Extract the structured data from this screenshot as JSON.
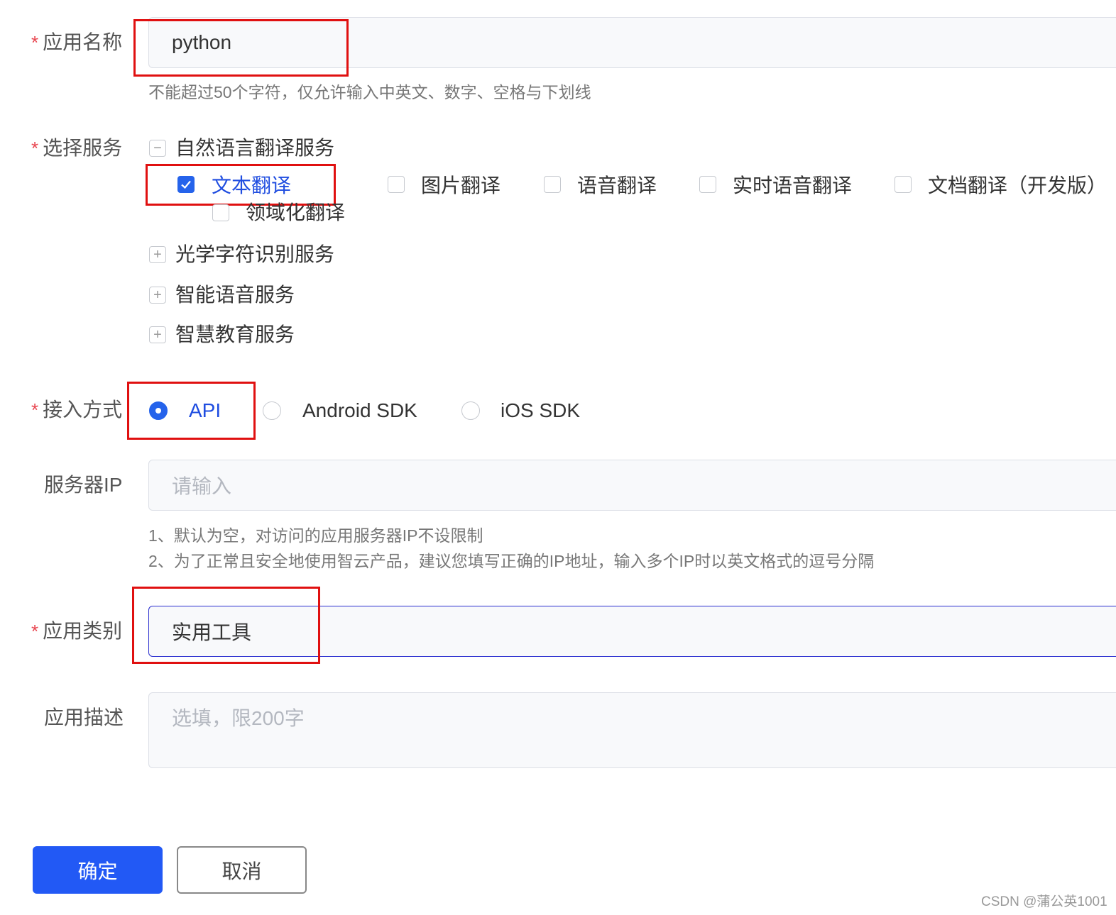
{
  "form": {
    "app_name": {
      "required_mark": "*",
      "label": "应用名称",
      "value": "python",
      "hint": "不能超过50个字符，仅允许输入中英文、数字、空格与下划线"
    },
    "services": {
      "required_mark": "*",
      "label": "选择服务",
      "groups": [
        {
          "label": "自然语言翻译服务",
          "toggle": "−",
          "expanded": true,
          "options": [
            {
              "label": "文本翻译",
              "checked": true
            },
            {
              "label": "图片翻译",
              "checked": false
            },
            {
              "label": "语音翻译",
              "checked": false
            },
            {
              "label": "实时语音翻译",
              "checked": false
            },
            {
              "label": "文档翻译（开发版）",
              "checked": false
            },
            {
              "label": "领域化翻译",
              "checked": false
            }
          ]
        },
        {
          "label": "光学字符识别服务",
          "toggle": "+",
          "expanded": false
        },
        {
          "label": "智能语音服务",
          "toggle": "+",
          "expanded": false
        },
        {
          "label": "智慧教育服务",
          "toggle": "+",
          "expanded": false
        }
      ]
    },
    "access_method": {
      "required_mark": "*",
      "label": "接入方式",
      "options": [
        {
          "label": "API",
          "selected": true
        },
        {
          "label": "Android SDK",
          "selected": false
        },
        {
          "label": "iOS SDK",
          "selected": false
        }
      ]
    },
    "server_ip": {
      "label": "服务器IP",
      "placeholder": "请输入",
      "hints": [
        "1、默认为空，对访问的应用服务器IP不设限制",
        "2、为了正常且安全地使用智云产品，建议您填写正确的IP地址，输入多个IP时以英文格式的逗号分隔"
      ]
    },
    "app_category": {
      "required_mark": "*",
      "label": "应用类别",
      "value": "实用工具"
    },
    "description": {
      "label": "应用描述",
      "placeholder": "选填，限200字"
    }
  },
  "buttons": {
    "confirm": "确定",
    "cancel": "取消"
  },
  "watermark": "CSDN @蒲公英1001",
  "colors": {
    "primary": "#2259f5",
    "required": "#e8454f",
    "highlight_box": "#e01010",
    "focus_border": "#2a2ecf"
  }
}
